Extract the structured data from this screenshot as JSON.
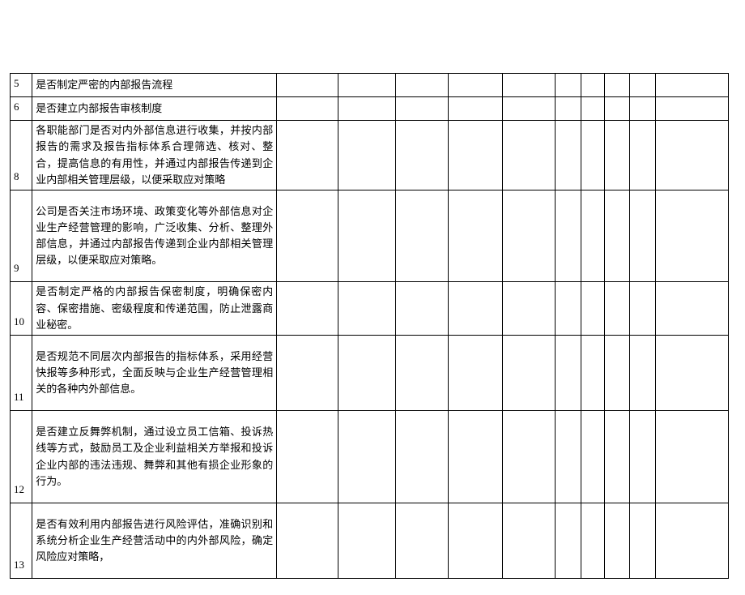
{
  "rows": [
    {
      "num": "5",
      "desc": "是否制定严密的内部报告流程",
      "padded": false
    },
    {
      "num": "6",
      "desc": "是否建立内部报告审核制度",
      "padded": false
    },
    {
      "num": "8",
      "desc": "各职能部门是否对内外部信息进行收集，并按内部报告的需求及报告指标体系合理筛选、核对、整合，提高信息的有用性，并通过内部报告传递到企业内部相关管理层级，以便采取应对策略",
      "padded": false
    },
    {
      "num": "9",
      "desc": "公司是否关注市场环境、政策变化等外部信息对企业生产经营管理的影响，广泛收集、分析、整理外部信息，并通过内部报告传递到企业内部相关管理层级，以便采取应对策略。",
      "padded": true
    },
    {
      "num": "10",
      "desc": "是否制定严格的内部报告保密制度，明确保密内容、保密措施、密级程度和传递范围，防止泄露商业秘密。",
      "padded": false
    },
    {
      "num": "11",
      "desc": "是否规范不同层次内部报告的指标体系，采用经营快报等多种形式，全面反映与企业生产经营管理相关的各种内外部信息。",
      "padded": true
    },
    {
      "num": "12",
      "desc": "是否建立反舞弊机制，通过设立员工信箱、投诉热线等方式，鼓励员工及企业利益相关方举报和投诉企业内部的违法违规、舞弊和其他有损企业形象的行为。",
      "padded": true
    },
    {
      "num": "13",
      "desc": "是否有效利用内部报告进行风险评估，准确识别和系统分析企业生产经营活动中的内外部风险，确定风险应对策略，",
      "padded": true
    }
  ]
}
